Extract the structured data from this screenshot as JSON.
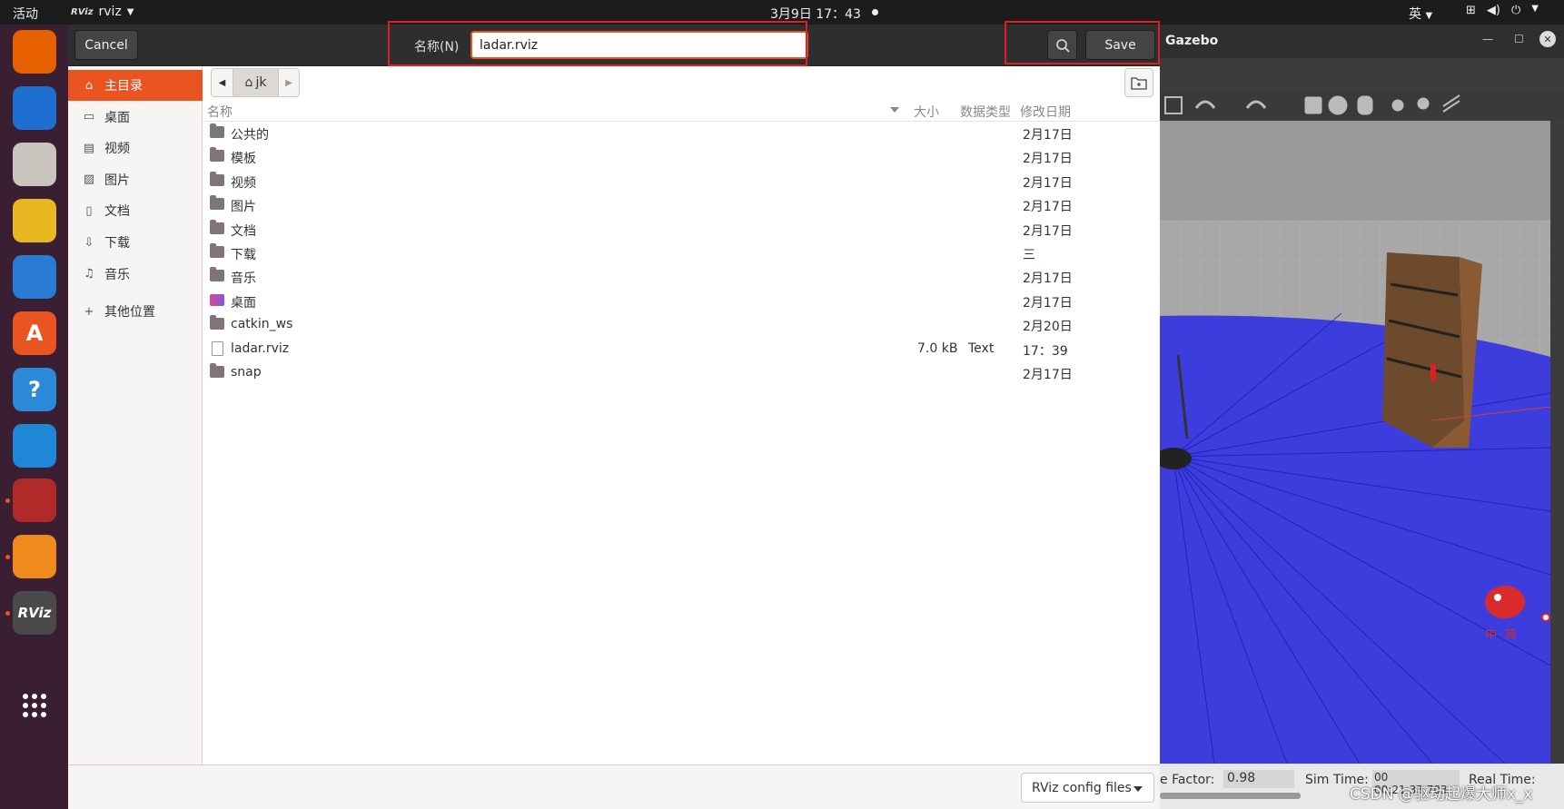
{
  "topbar": {
    "activities": "活动",
    "app_logo": "RViz",
    "app_name": "rviz",
    "clock": "3月9日  17：43",
    "input_method": "英"
  },
  "gazebo": {
    "title": "Gazebo",
    "status": {
      "factor_label": "e Factor:",
      "factor_value": "0.98",
      "sim_time_label": "Sim Time:",
      "sim_time_value": "00 00:21:33.703",
      "real_time_label": "Real Time:"
    },
    "overlay_chars": [
      "中",
      "简"
    ]
  },
  "dialog": {
    "cancel_label": "Cancel",
    "name_label": "名称(N)",
    "name_value": "ladar.rviz",
    "save_label": "Save",
    "sidebar": [
      {
        "label": "主目录",
        "icon": "home-icon",
        "glyph": "⌂",
        "active": true
      },
      {
        "label": "桌面",
        "icon": "desktop-icon",
        "glyph": "▭",
        "active": false
      },
      {
        "label": "视频",
        "icon": "video-icon",
        "glyph": "▤",
        "active": false
      },
      {
        "label": "图片",
        "icon": "image-icon",
        "glyph": "▨",
        "active": false
      },
      {
        "label": "文档",
        "icon": "document-icon",
        "glyph": "▯",
        "active": false
      },
      {
        "label": "下载",
        "icon": "download-icon",
        "glyph": "⇩",
        "active": false
      },
      {
        "label": "音乐",
        "icon": "music-icon",
        "glyph": "♫",
        "active": false
      }
    ],
    "other_locations": "其他位置",
    "path": {
      "current": "jk"
    },
    "columns": {
      "name": "名称",
      "size": "大小",
      "type": "数据类型",
      "modified": "修改日期"
    },
    "files": [
      {
        "name": "公共的",
        "kind": "folder",
        "size": "",
        "type": "",
        "modified": "2月17日"
      },
      {
        "name": "模板",
        "kind": "folder",
        "size": "",
        "type": "",
        "modified": "2月17日"
      },
      {
        "name": "视频",
        "kind": "folder",
        "size": "",
        "type": "",
        "modified": "2月17日"
      },
      {
        "name": "图片",
        "kind": "folder",
        "size": "",
        "type": "",
        "modified": "2月17日"
      },
      {
        "name": "文档",
        "kind": "folder",
        "size": "",
        "type": "",
        "modified": "2月17日"
      },
      {
        "name": "下载",
        "kind": "folder",
        "size": "",
        "type": "",
        "modified": "三"
      },
      {
        "name": "音乐",
        "kind": "folder",
        "size": "",
        "type": "",
        "modified": "2月17日"
      },
      {
        "name": "桌面",
        "kind": "desktop",
        "size": "",
        "type": "",
        "modified": "2月17日"
      },
      {
        "name": "catkin_ws",
        "kind": "folder",
        "size": "",
        "type": "",
        "modified": "2月20日"
      },
      {
        "name": "ladar.rviz",
        "kind": "file",
        "size": "7.0 kB",
        "type": "Text",
        "modified": "17：39"
      },
      {
        "name": "snap",
        "kind": "folder",
        "size": "",
        "type": "",
        "modified": "2月17日"
      }
    ],
    "filter": "RViz config files"
  },
  "dock": [
    {
      "name": "firefox-icon",
      "glyph": "",
      "bg": "#e66000",
      "running": false
    },
    {
      "name": "thunderbird-icon",
      "glyph": "",
      "bg": "#1f6fd1",
      "running": false
    },
    {
      "name": "files-icon",
      "glyph": "",
      "bg": "#c9c4bd",
      "running": false
    },
    {
      "name": "rhythmbox-icon",
      "glyph": "",
      "bg": "#e8b823",
      "running": false
    },
    {
      "name": "writer-icon",
      "glyph": "",
      "bg": "#2a7bd3",
      "running": false
    },
    {
      "name": "software-center-icon",
      "glyph": "A",
      "bg": "#e95420",
      "running": false
    },
    {
      "name": "help-icon",
      "glyph": "?",
      "bg": "#2a8ad8",
      "running": false
    },
    {
      "name": "vscode-icon",
      "glyph": "",
      "bg": "#1e88d6",
      "running": false
    },
    {
      "name": "terminal-icon",
      "glyph": "",
      "bg": "#b02a2a",
      "running": true
    },
    {
      "name": "gazebo-icon",
      "glyph": "",
      "bg": "#f08a1c",
      "running": true
    },
    {
      "name": "rviz-icon",
      "glyph": "RViz",
      "bg": "#4a4a4a",
      "running": true
    },
    {
      "name": "show-apps-icon",
      "glyph": "",
      "bg": "transparent",
      "running": false
    }
  ],
  "watermark": "CSDN @驱动起爆大师x_x",
  "colors": {
    "accent": "#e95420",
    "highlight_box": "#e02020",
    "laser": "#1a1aff"
  }
}
